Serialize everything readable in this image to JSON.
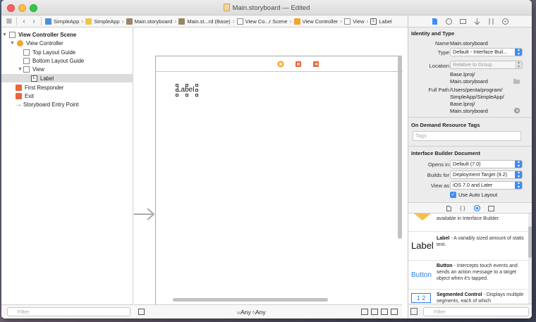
{
  "window": {
    "title": "Main.storyboard — Edited"
  },
  "jumpbar": {
    "crumbs": [
      "SimpleApp",
      "SimpleApp",
      "Main.storyboard",
      "Main.st...rd (Base)",
      "View Co...r Scene",
      "View Controller",
      "View",
      "Label"
    ]
  },
  "outline": {
    "items": [
      {
        "label": "View Controller Scene"
      },
      {
        "label": "View Controller"
      },
      {
        "label": "Top Layout Guide"
      },
      {
        "label": "Bottom Layout Guide"
      },
      {
        "label": "View"
      },
      {
        "label": "Label"
      },
      {
        "label": "First Responder"
      },
      {
        "label": "Exit"
      },
      {
        "label": "Storyboard Entry Point"
      }
    ],
    "filter_placeholder": "Filter"
  },
  "canvas": {
    "label_text": "Label",
    "size_class_w_prefix": "w",
    "size_class_w": "Any",
    "size_class_h_prefix": "h",
    "size_class_h": "Any"
  },
  "inspector": {
    "identity_title": "Identity and Type",
    "name_label": "Name",
    "name_value": "Main.storyboard",
    "type_label": "Type",
    "type_value": "Default - Interface Buil...",
    "location_label": "Location",
    "location_value": "Relative to Group",
    "location_path_1": "Base.lproj/",
    "location_path_2": "Main.storyboard",
    "fullpath_label": "Full Path",
    "fullpath_1": "/Users/penta/program/",
    "fullpath_2": "SimpleApp/SimpleApp/",
    "fullpath_3": "Base.lproj/",
    "fullpath_4": "Main.storyboard",
    "odr_title": "On Demand Resource Tags",
    "tags_placeholder": "Tags",
    "ib_title": "Interface Builder Document",
    "opens_in_label": "Opens in",
    "opens_in_value": "Default (7.0)",
    "builds_for_label": "Builds for",
    "builds_for_value": "Deployment Target (9.2)",
    "view_as_label": "View as",
    "view_as_value": "iOS 7.0 and Later",
    "auto_layout_label": "Use Auto Layout"
  },
  "library": {
    "partial_text": "available in Interface Builder.",
    "items": [
      {
        "icon_text": "Label",
        "name": "Label",
        "desc": " - A variably sized amount of static text."
      },
      {
        "icon_text": "Button",
        "name": "Button",
        "desc": " - Intercepts touch events and sends an action message to a target object when it's tapped."
      },
      {
        "icon_text": "1 2",
        "name": "Segmented Control",
        "desc": " - Displays multiple segments, each of which"
      }
    ],
    "filter_placeholder": "Filter"
  },
  "colors": {
    "accent": "#3d8df5",
    "vc_icon": "#f3a42b",
    "responder_icon": "#e8673a"
  }
}
